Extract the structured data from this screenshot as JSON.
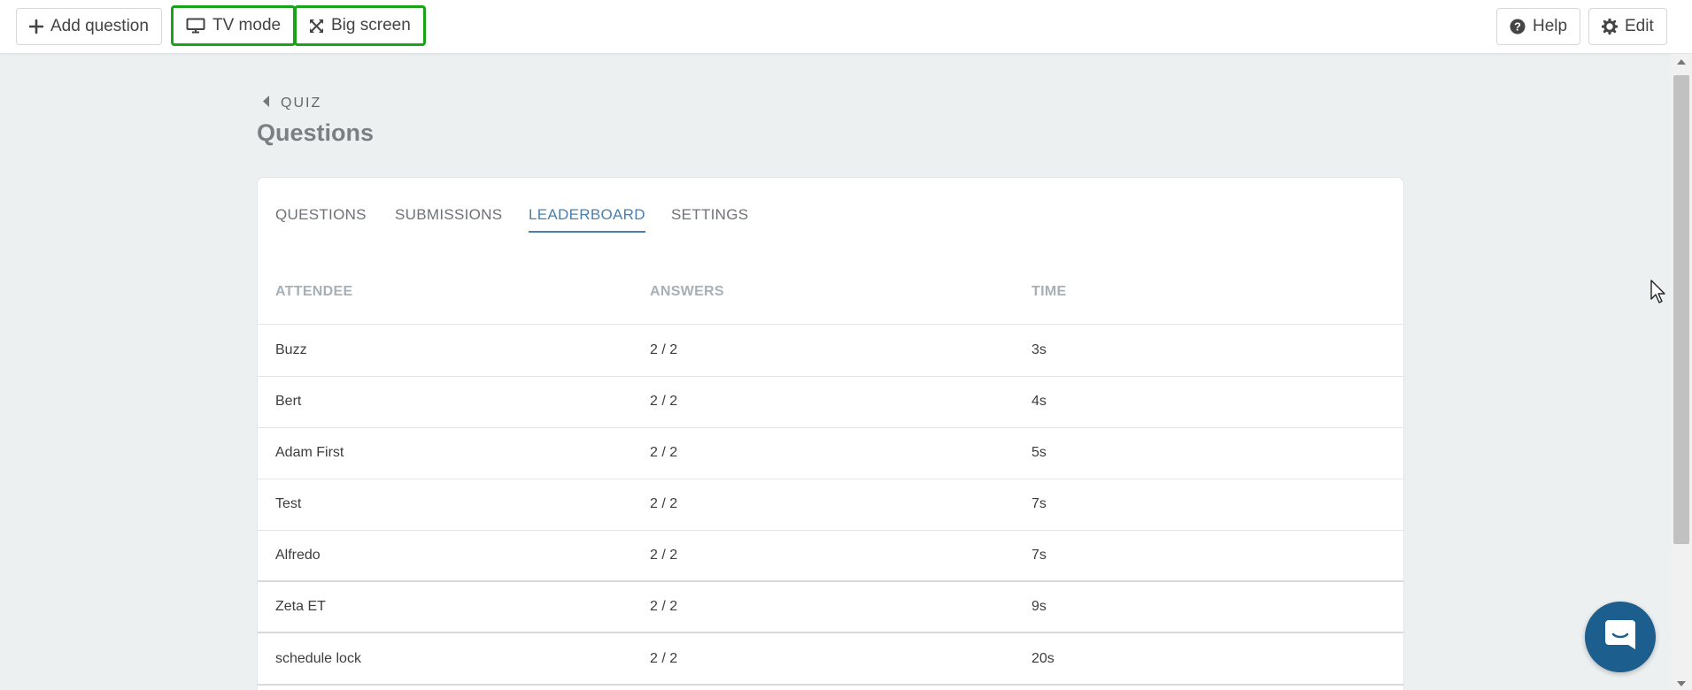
{
  "toolbar": {
    "add_question": "Add question",
    "tv_mode": "TV mode",
    "big_screen": "Big screen",
    "help": "Help",
    "edit": "Edit"
  },
  "breadcrumb": {
    "label": "QUIZ"
  },
  "page": {
    "title": "Questions"
  },
  "tabs": [
    {
      "label": "QUESTIONS",
      "active": false
    },
    {
      "label": "SUBMISSIONS",
      "active": false
    },
    {
      "label": "LEADERBOARD",
      "active": true
    },
    {
      "label": "SETTINGS",
      "active": false
    }
  ],
  "table": {
    "columns": [
      "ATTENDEE",
      "ANSWERS",
      "TIME"
    ],
    "rows": [
      {
        "attendee": "Buzz",
        "answers": "2 / 2",
        "time": "3s"
      },
      {
        "attendee": "Bert",
        "answers": "2 / 2",
        "time": "4s"
      },
      {
        "attendee": "Adam First",
        "answers": "2 / 2",
        "time": "5s"
      },
      {
        "attendee": "Test",
        "answers": "2 / 2",
        "time": "7s"
      },
      {
        "attendee": "Alfredo",
        "answers": "2 / 2",
        "time": "7s"
      },
      {
        "attendee": "Zeta ET",
        "answers": "2 / 2",
        "time": "9s"
      },
      {
        "attendee": "schedule lock",
        "answers": "2 / 2",
        "time": "20s"
      }
    ]
  },
  "icons": {
    "add": "plus-icon",
    "tv": "monitor-icon",
    "big_screen": "expand-arrows-icon",
    "help": "question-circle-icon",
    "edit": "gear-icon",
    "back": "caret-left-icon",
    "chat": "chat-bubble-icon"
  },
  "colors": {
    "highlight_border": "#19a319",
    "active_tab": "#4a7fb0",
    "chat_button": "#1c5f8e",
    "background": "#edf0f1"
  }
}
